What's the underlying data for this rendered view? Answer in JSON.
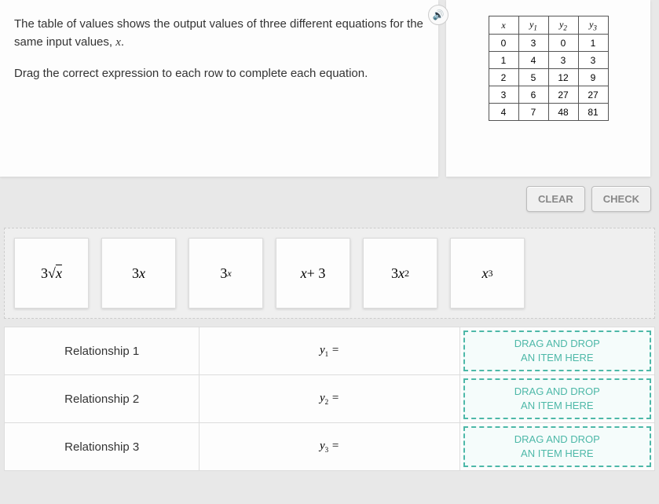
{
  "problem": {
    "line1_a": "The table of values shows the output values of three different equations for the",
    "line1_b": "same input values, ",
    "var": "x",
    "period": ".",
    "line2": "Drag the correct expression to each row to complete each equation."
  },
  "audio_icon": "🔊",
  "table": {
    "headers": {
      "x": "x",
      "y1": "y",
      "y1s": "1",
      "y2": "y",
      "y2s": "2",
      "y3": "y",
      "y3s": "3"
    },
    "rows": [
      {
        "x": "0",
        "y1": "3",
        "y2": "0",
        "y3": "1"
      },
      {
        "x": "1",
        "y1": "4",
        "y2": "3",
        "y3": "3"
      },
      {
        "x": "2",
        "y1": "5",
        "y2": "12",
        "y3": "9"
      },
      {
        "x": "3",
        "y1": "6",
        "y2": "27",
        "y3": "27"
      },
      {
        "x": "4",
        "y1": "7",
        "y2": "48",
        "y3": "81"
      }
    ]
  },
  "buttons": {
    "clear": "CLEAR",
    "check": "CHECK"
  },
  "tiles": {
    "t1a": "3",
    "t1b": "x",
    "t2": "3",
    "t2v": "x",
    "t3": "3",
    "t3e": "x",
    "t4v": "x",
    "t4": " + 3",
    "t5": "3",
    "t5v": "x",
    "t5e": "2",
    "t6v": "x",
    "t6e": "3"
  },
  "relationships": {
    "r1": "Relationship 1",
    "e1a": "y",
    "e1s": "1",
    "e1b": " =",
    "r2": "Relationship 2",
    "e2a": "y",
    "e2s": "2",
    "e2b": " =",
    "r3": "Relationship 3",
    "e3a": "y",
    "e3s": "3",
    "e3b": " ="
  },
  "dropzone": {
    "l1": "DRAG AND DROP",
    "l2": "AN ITEM HERE"
  }
}
